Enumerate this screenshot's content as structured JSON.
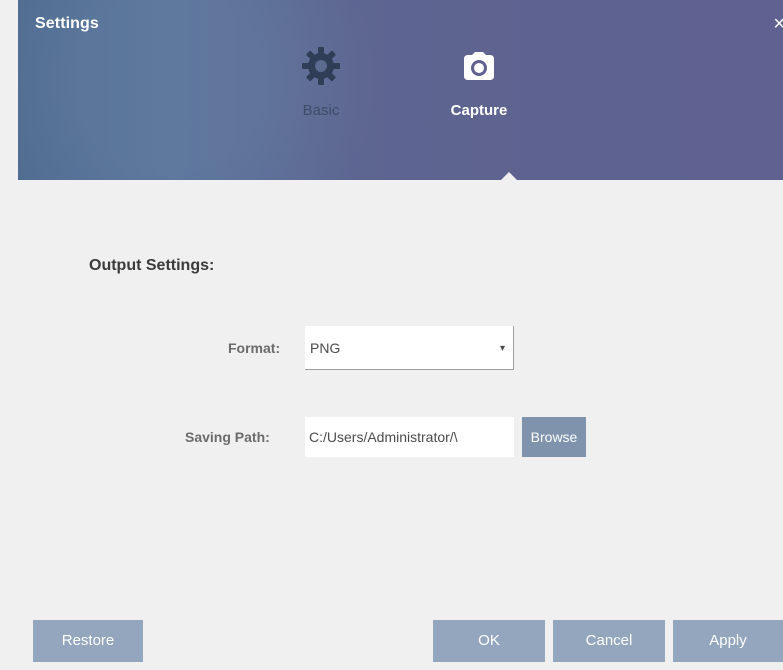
{
  "window": {
    "title": "Settings",
    "close_label": "×"
  },
  "tabs": [
    {
      "label": "Basic",
      "icon": "gear-icon",
      "active": false
    },
    {
      "label": "Capture",
      "icon": "camera-icon",
      "active": true
    }
  ],
  "content": {
    "section_heading": "Output Settings:",
    "format": {
      "label": "Format:",
      "value": "PNG",
      "arrow": "▾"
    },
    "saving_path": {
      "label": "Saving Path:",
      "value": "C:/Users/Administrator/\\",
      "browse_label": "Browse"
    }
  },
  "footer": {
    "restore_label": "Restore",
    "ok_label": "OK",
    "cancel_label": "Cancel",
    "apply_label": "Apply"
  },
  "colors": {
    "header_blue": "#5d6591",
    "accent_button": "#93a6be",
    "browse_button": "#7f93ad",
    "background": "#f0f0f0"
  }
}
